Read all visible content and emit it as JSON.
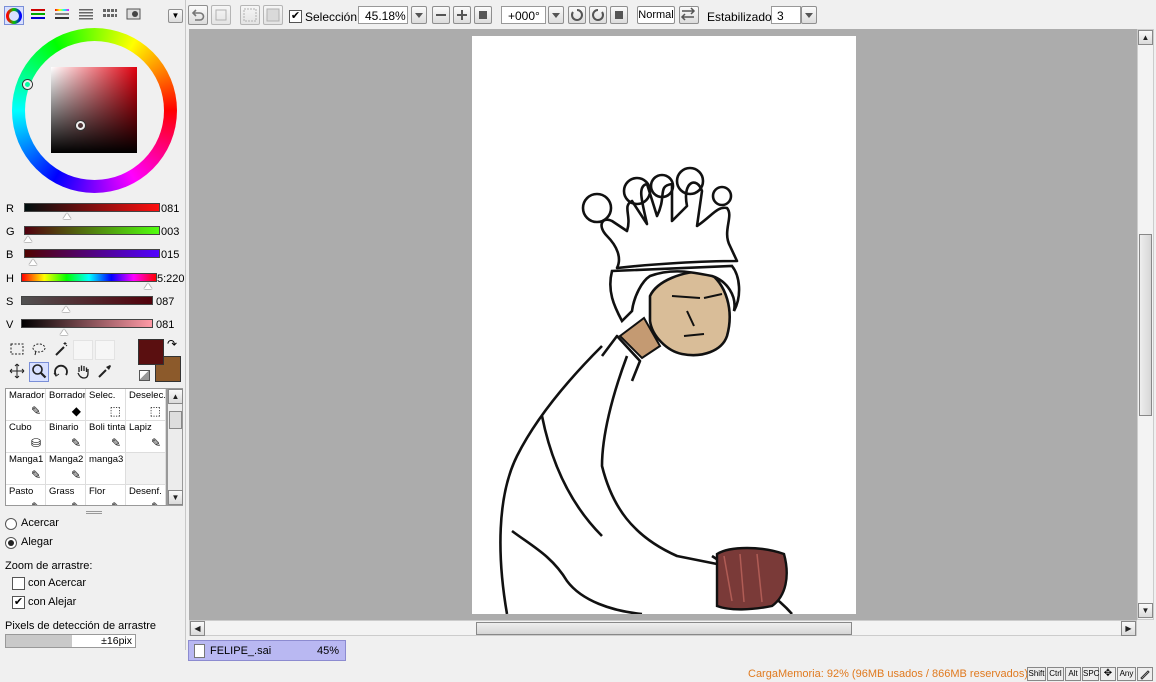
{
  "app": {
    "accent": "#b9b8f2"
  },
  "color_panel": {
    "tabs": [
      "color-wheel-icon",
      "rgb-sliders-icon",
      "hsv-sliders-icon",
      "swatches-icon",
      "palette-icon",
      "scratchpad-icon"
    ],
    "current_color": "#5a0f10",
    "secondary_color": "#8c5a2b",
    "sliders": [
      {
        "label": "R",
        "value": "081",
        "color": "#510f0f"
      },
      {
        "label": "G",
        "value": "003",
        "color": "#510f0f"
      },
      {
        "label": "B",
        "value": "015",
        "color": "#510f0f"
      },
      {
        "label": "H",
        "value": "5:220",
        "color": "#ff0000"
      },
      {
        "label": "S",
        "value": "087",
        "color": "#510f0f"
      },
      {
        "label": "V",
        "value": "081",
        "color": "#510f0f"
      }
    ],
    "slider_levels": {
      "R": 0.32,
      "G": 0.01,
      "B": 0.06,
      "H": 0.99,
      "S": 0.34,
      "V": 0.32
    }
  },
  "tools": {
    "icons": [
      "rect-select-icon",
      "lasso-select-icon",
      "magic-wand-icon",
      "move-icon",
      "zoom-icon",
      "rotate-icon",
      "hand-icon",
      "eyedropper-icon"
    ],
    "selected": "zoom-icon"
  },
  "brushes": [
    {
      "label": "Marador",
      "icon": "pen-icon"
    },
    {
      "label": "Borrador",
      "icon": "eraser-icon"
    },
    {
      "label": "Selec.",
      "icon": "select-brush-icon"
    },
    {
      "label": "Deselec.",
      "icon": "deselect-brush-icon"
    },
    {
      "label": "Cubo",
      "icon": "bucket-icon"
    },
    {
      "label": "Binario",
      "icon": "pen-icon"
    },
    {
      "label": "Boli tinta",
      "icon": "pen-icon"
    },
    {
      "label": "Lapiz",
      "icon": "pen-icon"
    },
    {
      "label": "Manga1",
      "icon": "pen-icon"
    },
    {
      "label": "Manga2",
      "icon": "pen-icon"
    },
    {
      "label": "manga3",
      "icon": ""
    },
    {
      "label": "",
      "icon": ""
    },
    {
      "label": "Pasto",
      "icon": "pen-icon"
    },
    {
      "label": "Grass",
      "icon": "pen-icon"
    },
    {
      "label": "Flor",
      "icon": "pen-icon"
    },
    {
      "label": "Desenf.",
      "icon": "pen-icon"
    }
  ],
  "zoom_options": {
    "acercar": "Acercar",
    "alegar": "Alegar",
    "drag_zoom_label": "Zoom de arrastre:",
    "con_acercar": "con Acercar",
    "con_alejar": "con Alejar",
    "pixel_detect_label": "Pixels de detección de arrastre",
    "pixel_detect_value": "±16pix"
  },
  "toolbar": {
    "seleccion_label": "Selección",
    "zoom_value": "45.18%",
    "rotation_value": "+000°",
    "blend_mode": "Normal",
    "stabilizer_label": "Estabilizador",
    "stabilizer_value": "3"
  },
  "document": {
    "name": "FELIPE_.sai",
    "zoom": "45%"
  },
  "status": {
    "memory": "CargaMemoria: 92% (96MB usados / 866MB reservados)",
    "keys": [
      "Shift",
      "Ctrl",
      "Alt",
      "SPC",
      "✥",
      "Any"
    ]
  }
}
